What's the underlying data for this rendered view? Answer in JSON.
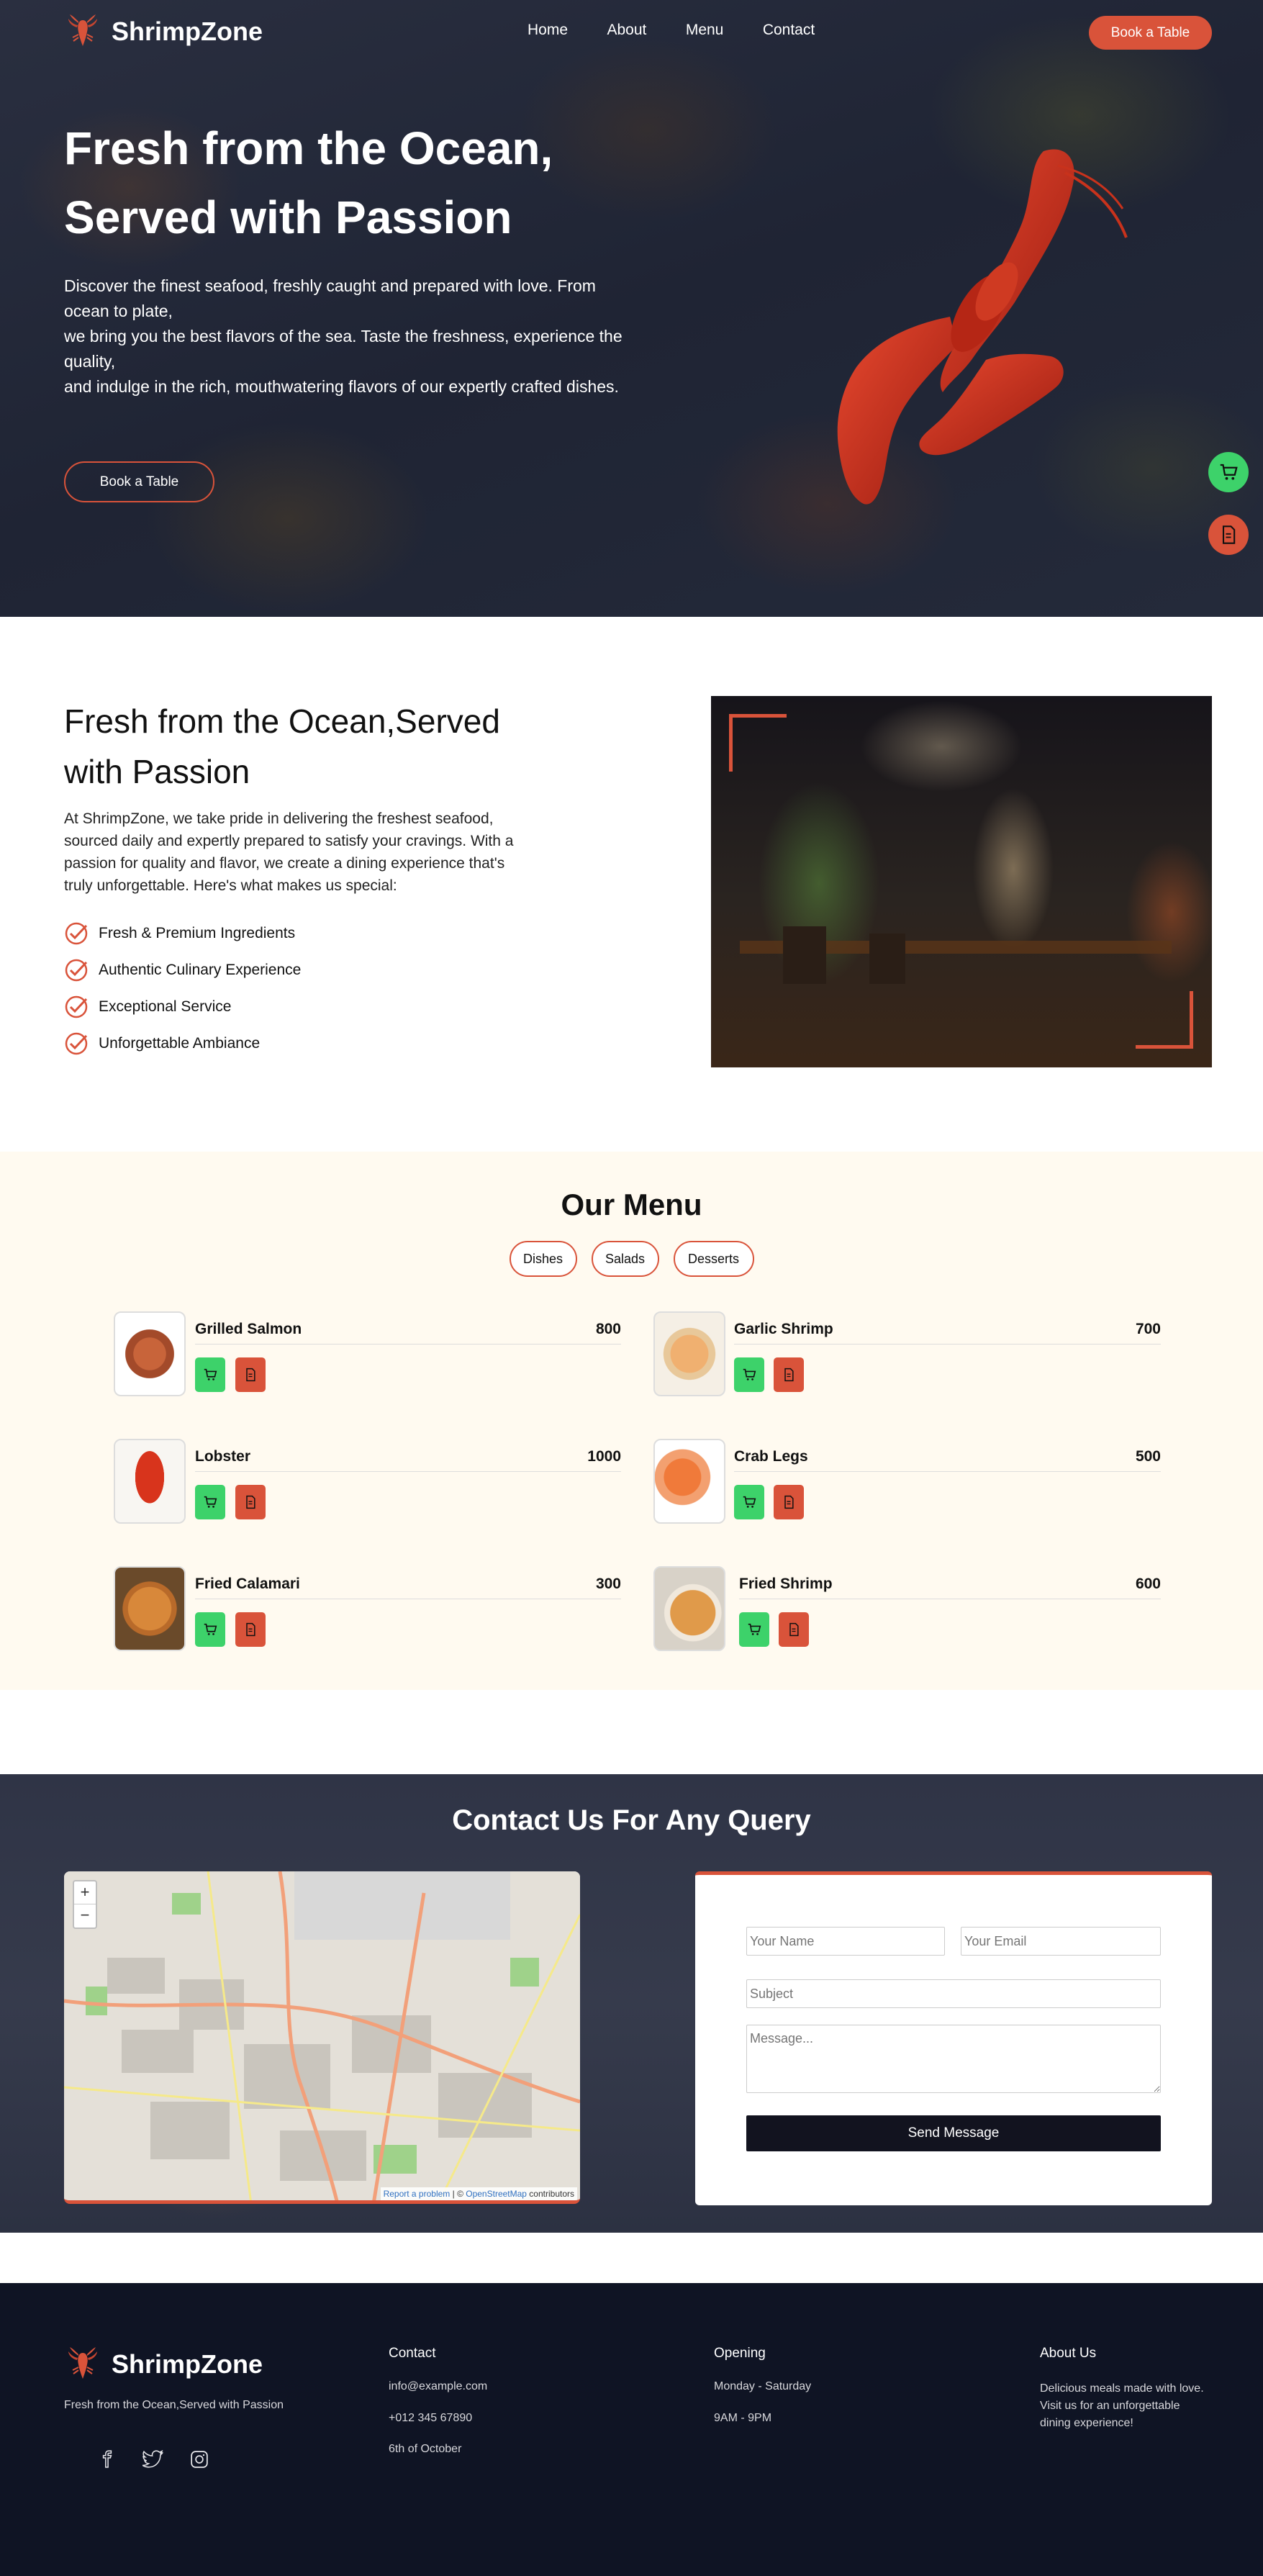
{
  "brand": {
    "name": "ShrimpZone",
    "accent": "#d9533a",
    "green": "#3dd26a",
    "dark": "#0f1424"
  },
  "nav": {
    "items": [
      "Home",
      "About",
      "Menu",
      "Contact"
    ],
    "cta": "Book a Table"
  },
  "hero": {
    "title_line1": "Fresh from the Ocean,",
    "title_line2": "Served with Passion",
    "desc_line1": "Discover the finest seafood, freshly caught and prepared with love. From ocean to plate,",
    "desc_line2": "we bring you the best flavors of the sea. Taste the freshness, experience the quality,",
    "desc_line3": "and indulge in the rich, mouthwatering flavors of our expertly crafted dishes.",
    "button": "Book a Table"
  },
  "floating": {
    "cart_icon": "cart-icon",
    "menu_icon": "document-icon"
  },
  "about": {
    "title_line1": "Fresh from the Ocean,Served",
    "title_line2": "with Passion",
    "desc": "At ShrimpZone, we take pride in delivering the freshest seafood, sourced daily and expertly prepared to satisfy your cravings. With a passion for quality and flavor, we create a dining experience that's truly unforgettable. Here's what makes us special:",
    "features": [
      "Fresh & Premium Ingredients",
      "Authentic Culinary Experience",
      "Exceptional Service",
      "Unforgettable Ambiance"
    ]
  },
  "menu": {
    "title": "Our Menu",
    "tabs": [
      "Dishes",
      "Salads",
      "Desserts"
    ],
    "items": [
      {
        "name": "Grilled Salmon",
        "price": "800"
      },
      {
        "name": "Garlic Shrimp",
        "price": "700"
      },
      {
        "name": "Lobster",
        "price": "1000"
      },
      {
        "name": "Crab Legs",
        "price": "500"
      },
      {
        "name": "Fried Calamari",
        "price": "300"
      },
      {
        "name": "Fried Shrimp",
        "price": "600"
      }
    ]
  },
  "contact": {
    "title": "Contact Us For Any Query",
    "map": {
      "zoom_in": "+",
      "zoom_out": "−",
      "report": "Report a problem",
      "sep": " | © ",
      "osm": "OpenStreetMap",
      "contrib": " contributors"
    },
    "form": {
      "name_placeholder": "Your Name",
      "email_placeholder": "Your Email",
      "subject_placeholder": "Subject",
      "message_placeholder": "Message...",
      "submit": "Send Message"
    }
  },
  "footer": {
    "tagline": "Fresh from the Ocean,Served with Passion",
    "contact_title": "Contact",
    "email": "info@example.com",
    "phone": "+012 345 67890",
    "address": "6th of October",
    "opening_title": "Opening",
    "days": "Monday - Saturday",
    "hours": "9AM - 9PM",
    "about_title": "About Us",
    "about_text": "Delicious meals made with love. Visit us for an unforgettable dining experience!",
    "social": [
      "facebook-icon",
      "twitter-icon",
      "instagram-icon"
    ]
  }
}
